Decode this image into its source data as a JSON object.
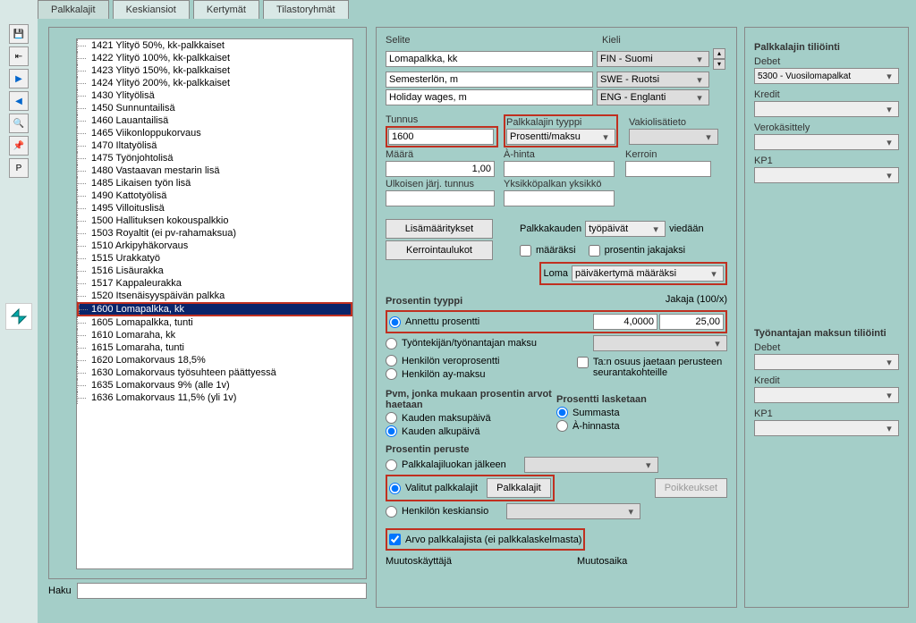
{
  "tabs": [
    "Palkkalajit",
    "Keskiansiot",
    "Kertymät",
    "Tilastoryhmät"
  ],
  "toolbar_icons": [
    "save",
    "exit",
    "next",
    "prev",
    "search",
    "pin",
    "P"
  ],
  "tree": [
    "1421 Ylityö 50%, kk-palkkaiset",
    "1422 Ylityö 100%, kk-palkkaiset",
    "1423 Ylityö 150%, kk-palkkaiset",
    "1424 Ylityö 200%, kk-palkkaiset",
    "1430 Ylityölisä",
    "1450 Sunnuntailisä",
    "1460 Lauantailisä",
    "1465 Viikonloppukorvaus",
    "1470 Iltatyölisä",
    "1475 Työnjohtolisä",
    "1480 Vastaavan mestarin lisä",
    "1485 Likaisen työn lisä",
    "1490 Kattotyölisä",
    "1495 Villoituslisä",
    "1500 Hallituksen kokouspalkkio",
    "1503 Royaltit (ei pv-rahamaksua)",
    "1510 Arkipyhäkorvaus",
    "1515 Urakkatyö",
    "1516 Lisäurakka",
    "1517 Kappaleurakka",
    "1520 Itsenäisyyspäivän palkka",
    "1600 Lomapalkka, kk",
    "1605 Lomapalkka, tunti",
    "1610 Lomaraha, kk",
    "1615 Lomaraha, tunti",
    "1620 Lomakorvaus 18,5%",
    "1630 Lomakorvaus työsuhteen päättyessä",
    "1635 Lomakorvaus 9% (alle 1v)",
    "1636 Lomakorvaus 11,5% (yli 1v)"
  ],
  "tree_selected_index": 21,
  "haku_label": "Haku",
  "selite": {
    "label": "Selite",
    "kieli_label": "Kieli",
    "rows": [
      {
        "text": "Lomapalkka, kk",
        "lang": "FIN - Suomi"
      },
      {
        "text": "Semesterlön, m",
        "lang": "SWE - Ruotsi"
      },
      {
        "text": "Holiday wages, m",
        "lang": "ENG - Englanti"
      }
    ]
  },
  "tunnus": {
    "label": "Tunnus",
    "value": "1600"
  },
  "tyyppi": {
    "label": "Palkkalajin tyyppi",
    "value": "Prosentti/maksu"
  },
  "vakio": {
    "label": "Vakiolisätieto",
    "value": ""
  },
  "maara": {
    "label": "Määrä",
    "value": "1,00"
  },
  "ahinta": {
    "label": "À-hinta",
    "value": ""
  },
  "kerroin": {
    "label": "Kerroin",
    "value": ""
  },
  "ulkoinen": {
    "label": "Ulkoisen järj. tunnus",
    "value": ""
  },
  "yksikko": {
    "label": "Yksikköpalkan yksikkö",
    "value": ""
  },
  "btn_lisamaar": "Lisämääritykset",
  "btn_kerroin": "Kerrointaulukot",
  "palkkakauden": {
    "label": "Palkkakauden",
    "value": "työpäivät",
    "suffix": "viedään"
  },
  "chk_maaraksi": "määräksi",
  "chk_prosentin_jakajaksi": "prosentin jakajaksi",
  "loma": {
    "label": "Loma",
    "value": "päiväkertymä määräksi"
  },
  "prosentin_tyyppi_label": "Prosentin tyyppi",
  "jakaja_label": "Jakaja (100/x)",
  "radio_annettu": "Annettu prosentti",
  "annettu_val1": "4,0000",
  "annettu_val2": "25,00",
  "radio_tyontekijan": "Työntekijän/työnantajan maksu",
  "radio_henkilon_vero": "Henkilön veroprosentti",
  "radio_henkilon_ay": "Henkilön ay-maksu",
  "chk_tan_osuus": "Ta:n osuus jaetaan perusteen seurantakohteille",
  "pvm_label": "Pvm, jonka mukaan prosentin arvot haetaan",
  "radio_kauden_maksu": "Kauden maksupäivä",
  "radio_kauden_alku": "Kauden alkupäivä",
  "prosentti_lasketaan_label": "Prosentti lasketaan",
  "radio_summasta": "Summasta",
  "radio_ahinnasta": "À-hinnasta",
  "prosentin_peruste_label": "Prosentin peruste",
  "radio_palkkalajiluokan": "Palkkalajiluokan jälkeen",
  "radio_valitut": "Valitut palkkalajit",
  "btn_palkkalajit": "Palkkalajit",
  "btn_poikkeukset": "Poikkeukset",
  "radio_henkilon_keski": "Henkilön keskiansio",
  "chk_arvo": "Arvo palkkalajista (ei palkkalaskelmasta)",
  "muutoskayttaja": "Muutoskäyttäjä",
  "muutosaika": "Muutosaika",
  "right": {
    "tiliointi_label": "Palkkalajin tiliöinti",
    "debet": "Debet",
    "debet_value": "5300 - Vuosilomapalkat",
    "kredit": "Kredit",
    "verokasittely": "Verokäsittely",
    "kp1": "KP1",
    "tyonantajan_label": "Työnantajan maksun tiliöinti"
  }
}
